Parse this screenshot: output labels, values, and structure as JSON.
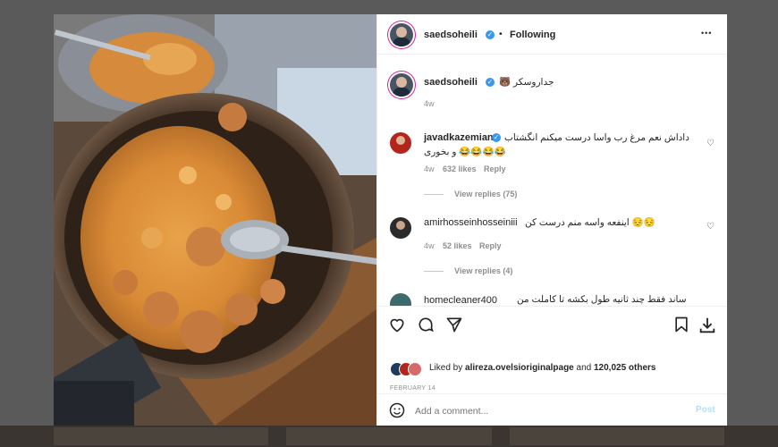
{
  "header": {
    "username": "saedsoheili",
    "dot": "•",
    "follow_status": "Following",
    "more": "•••"
  },
  "caption": {
    "username": "saedsoheili",
    "text": "جداروسکر 🐻",
    "time": "4w"
  },
  "comments": [
    {
      "username": "javadkazemian",
      "text_line1": "داداش نعم مرغ رب واسا درست میکنم انگشتاب",
      "text_line2": "😂😂😂😂 و بخوری",
      "time": "4w",
      "likes": "632 likes",
      "reply": "Reply",
      "view_replies": "View replies (75)"
    },
    {
      "username": "amirhosseinhosseiniii",
      "text": "😔😔 اینفعه واسه منم درست کن",
      "time": "4w",
      "likes": "52 likes",
      "reply": "Reply",
      "view_replies": "View replies (4)"
    },
    {
      "username": "homecleaner400",
      "text": "ساند فقط چند ثانیه طول بکشه تا کاملت من"
    }
  ],
  "likes_line": {
    "prefix": "Liked by ",
    "user": "alireza.ovelsioriginalpage",
    "middle": " and ",
    "count": "120,025 others"
  },
  "date": "FEBRUARY 14",
  "add_comment": {
    "placeholder": "Add a comment...",
    "post": "Post"
  },
  "colors": {
    "verified": "#3897f0",
    "story_ring": "#d6249f",
    "text": "#262626",
    "muted": "#8e8e8e"
  },
  "icons": [
    "heart-icon",
    "comment-icon",
    "share-icon",
    "bookmark-icon",
    "download-icon",
    "emoji-icon",
    "more-icon",
    "verified-icon"
  ]
}
